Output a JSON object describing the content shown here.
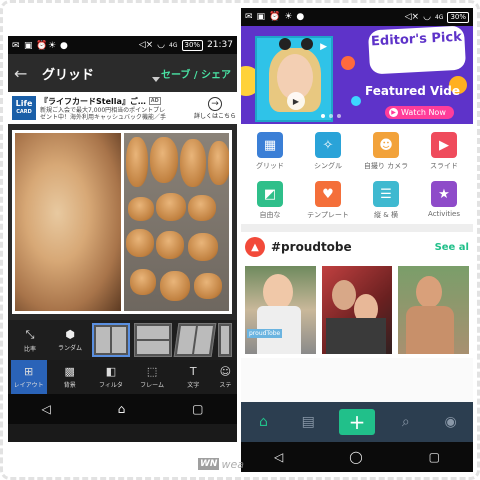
{
  "colors": {
    "accent_green": "#21c08a",
    "banner_purple": "#5e33c9",
    "watch_pink": "#ff3d9a",
    "layout_selected": "#2a63b8",
    "nav_dark": "#2c3e50"
  },
  "left_phone": {
    "status": {
      "time": "21:37",
      "battery": "30%",
      "signal": "4G"
    },
    "appbar": {
      "title": "グリッド",
      "save_share": "セーブ / シェア"
    },
    "ad": {
      "logo_line1": "Life",
      "logo_line2": "CARD",
      "title": "『ライフカードStella』ご…",
      "badge": "AD",
      "subtitle_1": "新規ご入会で最大7,000円相当のポイントプレ",
      "subtitle_2": "ゼント中！海外利用キャッシュバック機能／手",
      "detail_label": "詳しくはこちら"
    },
    "layout_tools": [
      {
        "label": "比率",
        "icon": "ratio-icon"
      },
      {
        "label": "ランダム",
        "icon": "dice-icon"
      }
    ],
    "bottom_tools": [
      {
        "label": "レイアウト",
        "icon": "layout-icon",
        "active": true
      },
      {
        "label": "背景",
        "icon": "background-icon",
        "active": false
      },
      {
        "label": "フィルタ",
        "icon": "filter-icon",
        "active": false
      },
      {
        "label": "フレーム",
        "icon": "frame-icon",
        "active": false
      },
      {
        "label": "文字",
        "icon": "text-icon",
        "active": false
      },
      {
        "label": "ステ",
        "icon": "sticker-icon",
        "active": false
      }
    ]
  },
  "right_phone": {
    "status": {
      "battery": "30%",
      "signal": "4G"
    },
    "banner": {
      "editors_pick": "Editor's Pick",
      "featured": "Featured Vide",
      "watch_now": "Watch Now"
    },
    "tools": [
      {
        "label": "グリッド",
        "icon": "grid-icon",
        "color": "#3b7fd6"
      },
      {
        "label": "シングル",
        "icon": "magic-wand-icon",
        "color": "#2aa3d8"
      },
      {
        "label": "自撮り カメラ",
        "icon": "cat-camera-icon",
        "color": "#f2a23a"
      },
      {
        "label": "スライド",
        "icon": "slideshow-icon",
        "color": "#ef4b5c"
      },
      {
        "label": "自由な",
        "icon": "freestyle-icon",
        "color": "#2fbf8a"
      },
      {
        "label": "テンプレート",
        "icon": "template-icon",
        "color": "#f46f3a"
      },
      {
        "label": "縦 & 横",
        "icon": "stitch-icon",
        "color": "#3fb9d0"
      },
      {
        "label": "Activities",
        "icon": "activities-icon",
        "color": "#8e4bc9"
      }
    ],
    "hashtag": {
      "text": "#proudtobe",
      "see_all": "See al"
    },
    "thumb_tag": "proudTobe",
    "watermark": "wea"
  }
}
